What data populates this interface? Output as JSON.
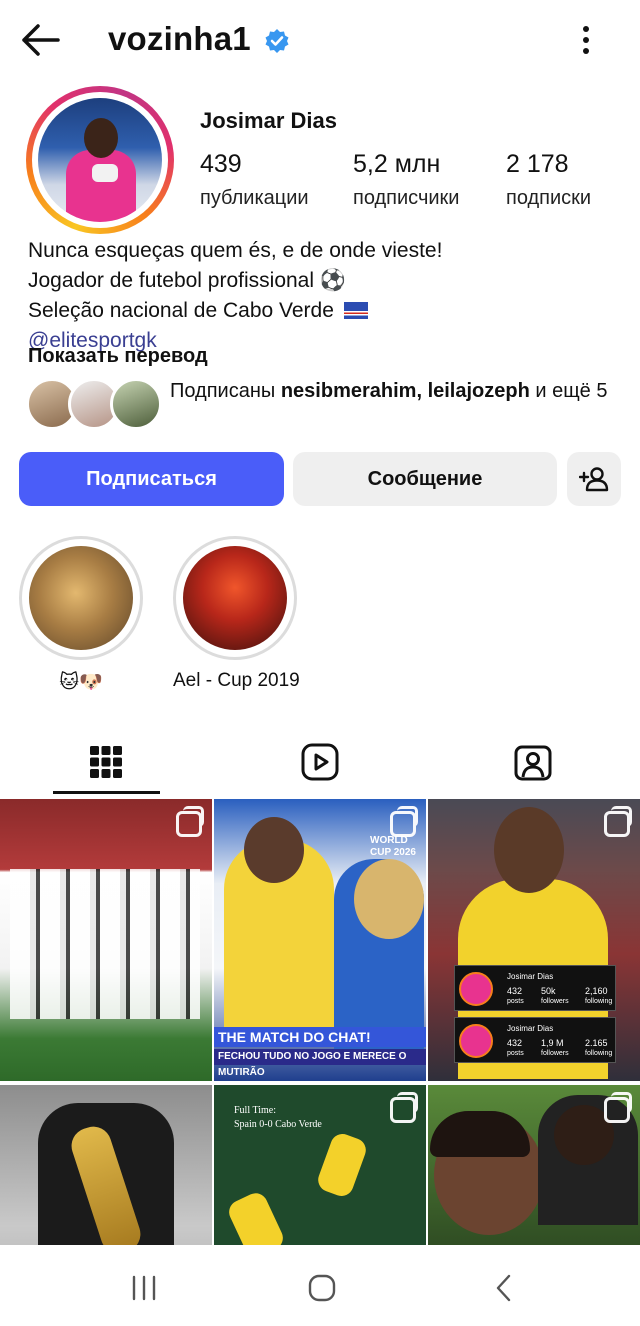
{
  "header": {
    "username": "vozinha1"
  },
  "profile": {
    "full_name": "Josimar Dias",
    "stats": [
      {
        "value": "439",
        "label": "публикации"
      },
      {
        "value": "5,2 млн",
        "label": "подписчики"
      },
      {
        "value": "2 178",
        "label": "подписки"
      }
    ],
    "bio": [
      "Nunca esqueças quem és, e de onde vieste!",
      "Jogador de futebol profissional ⚽",
      "Seleção nacional de Cabo Verde"
    ],
    "link": "@elitesportgk",
    "translate_label": "Показать перевод",
    "followed_by": {
      "prefix": "Подписаны",
      "names": "nesibmerahim, leilajozeph",
      "suffix": "и ещё 5"
    }
  },
  "actions": {
    "follow_label": "Подписаться",
    "message_label": "Сообщение"
  },
  "highlights": [
    {
      "label": "🐱🐶"
    },
    {
      "label": "Ael - Cup 2019"
    }
  ],
  "tabs": [
    {
      "name": "posts-grid-icon",
      "active": true
    },
    {
      "name": "reels-icon",
      "active": false
    },
    {
      "name": "tagged-icon",
      "active": false
    }
  ],
  "grid_posts": [
    {
      "caption": ""
    },
    {
      "caption": "THE MATCH DO CHAT!",
      "subcaption": "FECHOU TUDO NO JOGO E MERECE O MUTIRÃO",
      "badge": "WORLD CUP 2026"
    },
    {
      "caption": ""
    },
    {
      "caption": ""
    },
    {
      "caption": "Full Time:",
      "subcaption": "Spain 0-0 Cabo Verde"
    },
    {
      "caption": ""
    }
  ],
  "profile_cards": [
    {
      "name": "Josimar Dias",
      "posts": "432",
      "followers": "50k",
      "following": "2,160"
    },
    {
      "name": "Josimar Dias",
      "posts": "432",
      "followers": "1,9 M",
      "following": "2.165"
    }
  ],
  "card_labels": {
    "posts": "posts",
    "followers": "followers",
    "following": "following"
  },
  "colors": {
    "follow_button": "#4a5df9",
    "verified": "#3897f0",
    "link": "#3a3f92"
  }
}
